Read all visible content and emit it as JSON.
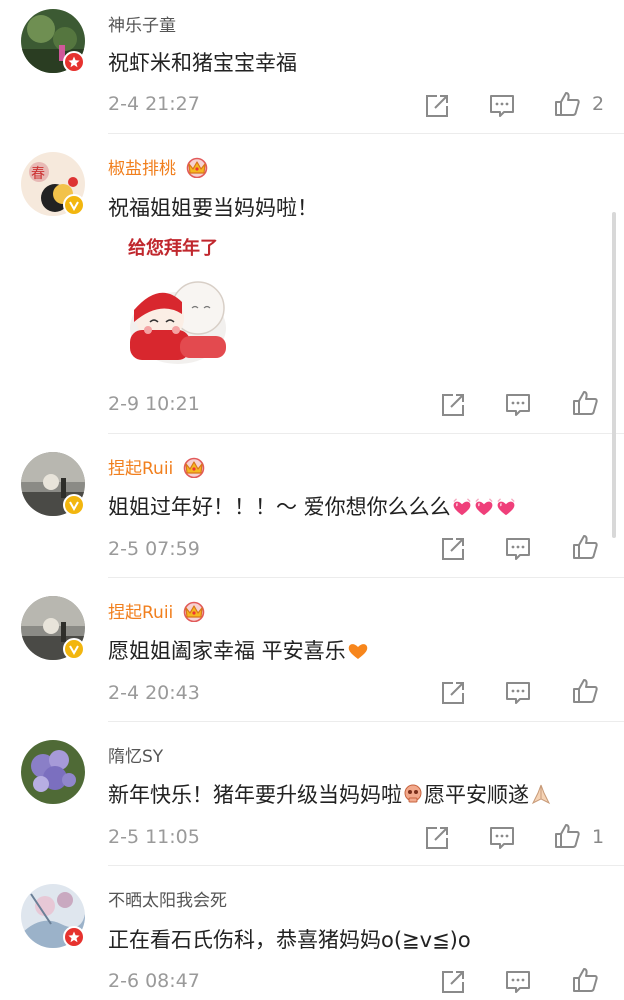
{
  "colors": {
    "vip_name": "#f17f1d",
    "text": "#222222",
    "meta": "#9a9a9a",
    "divider": "#ececec"
  },
  "comments": [
    {
      "username": "神乐子童",
      "badge": "red-star-badge",
      "text": "祝虾米和猪宝宝幸福",
      "time": "2-4 21:27",
      "likes": "2"
    },
    {
      "username": "椒盐排桃",
      "vip": true,
      "badge": "gold-v-badge",
      "text": "祝福姐姐要当妈妈啦！",
      "sticker_text": "给您拜年了",
      "time": "2-9 10:21"
    },
    {
      "username": "捏起Ruii",
      "vip": true,
      "badge": "gold-v-badge",
      "text": "姐姐过年好！！！～ 爱你想你么么么",
      "time": "2-5 07:59"
    },
    {
      "username": "捏起Ruii",
      "vip": true,
      "badge": "gold-v-badge",
      "text": "愿姐姐阖家幸福 平安喜乐",
      "time": "2-4 20:43"
    },
    {
      "username": "隋忆SY",
      "text": "新年快乐！猪年要升级当妈妈啦",
      "text2": "愿平安顺遂",
      "time": "2-5 11:05",
      "likes": "1"
    },
    {
      "username": "不晒太阳我会死",
      "badge": "red-star-badge",
      "text": "正在看石氏伤科，恭喜猪妈妈o(≧v≦)o",
      "time": "2-6 08:47"
    }
  ]
}
